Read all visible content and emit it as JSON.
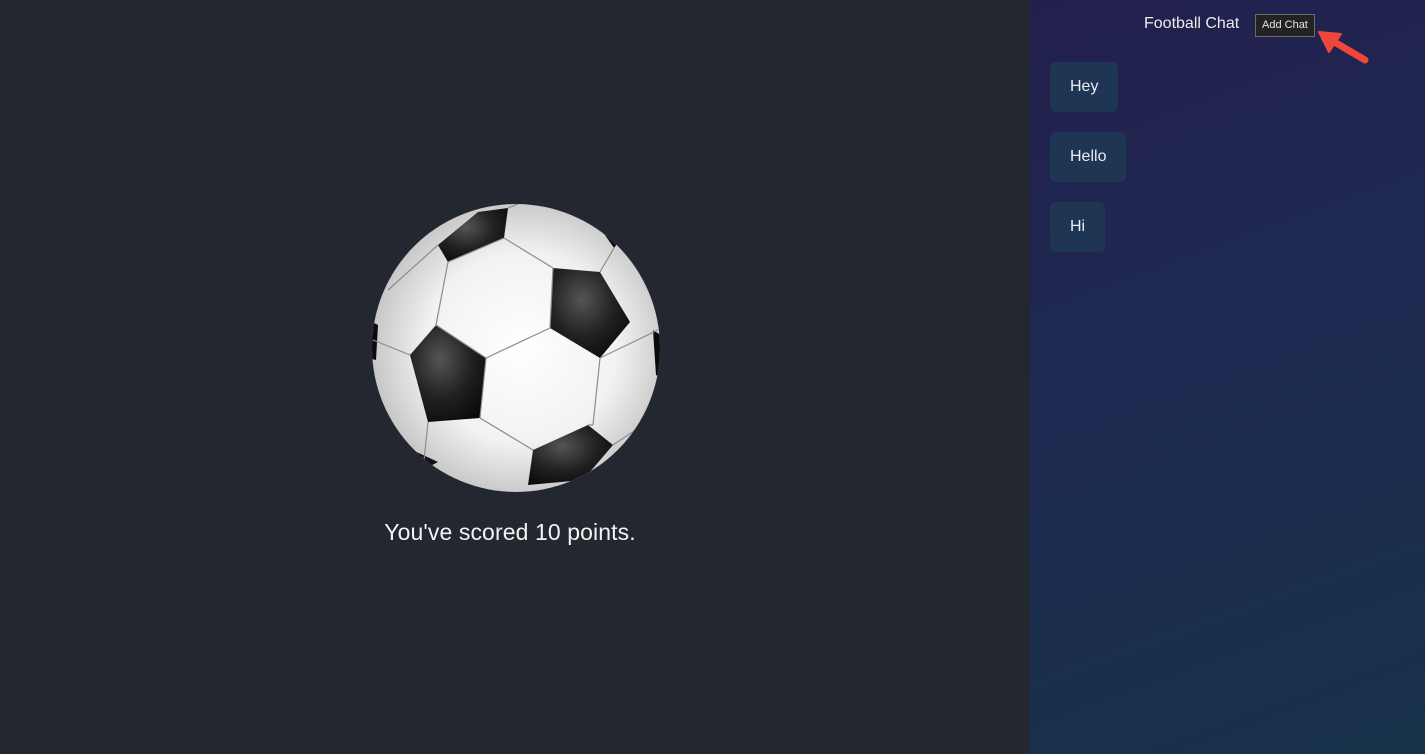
{
  "game": {
    "score_text": "You've scored 10 points."
  },
  "chat": {
    "title": "Football Chat",
    "add_chat_label": "Add Chat",
    "items": [
      {
        "label": "Hey"
      },
      {
        "label": "Hello"
      },
      {
        "label": "Hi"
      }
    ]
  },
  "colors": {
    "game_background": "#23272f",
    "chat_panel_gradient_start": "#221f4d",
    "chat_panel_gradient_end": "#18324a",
    "chat_item_background": "#1f3554",
    "annotation_arrow": "#f0453a"
  },
  "icons": {
    "ball": "soccer-ball-icon",
    "annotation": "red-arrow-icon"
  }
}
